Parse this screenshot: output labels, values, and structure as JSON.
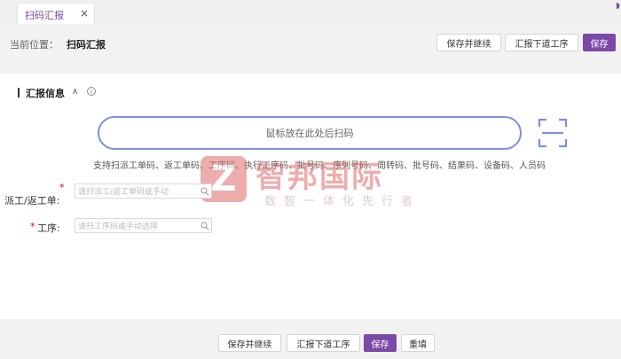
{
  "tabs": [
    {
      "label": "扫码汇报",
      "close": "×"
    }
  ],
  "breadcrumb": {
    "label": "当前位置：",
    "value": "扫码汇报"
  },
  "toolbar": {
    "save_continue": "保存并继续",
    "report_next": "汇报下道工序",
    "save": "保存"
  },
  "section": {
    "title": "汇报信息",
    "collapse_glyph": "∧",
    "info_glyph": "i"
  },
  "scan": {
    "placeholder": "鼠标放在此处后扫码",
    "support": "支持扫派工单码、返工单码、工序码、执行工序码、批号码、序列号码、周转码、批号码、结果码、设备码、人员码"
  },
  "form": {
    "dispatch": {
      "label": "派工/返工单:",
      "placeholder": "请扫派工/返工单码或手动"
    },
    "process": {
      "label": "工序:",
      "placeholder": "请扫工序码或手动选择"
    }
  },
  "watermark": {
    "logo": "Z",
    "title": "智邦国际",
    "subtitle": "数智一体化先行者"
  },
  "footer": {
    "save_continue": "保存并继续",
    "report_next": "汇报下道工序",
    "save": "保存",
    "reset": "重填"
  },
  "colors": {
    "accent": "#7b49a8",
    "scan_border": "#7e8fe0",
    "required": "#d9001b"
  }
}
